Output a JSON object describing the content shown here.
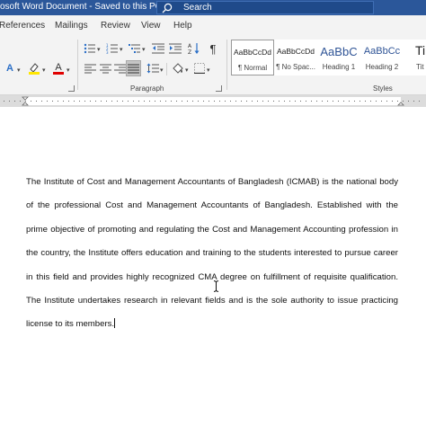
{
  "titlebar": {
    "doc_title": "osoft Word Document  -  Saved to this PC",
    "search_placeholder": "Search"
  },
  "tabs": [
    "References",
    "Mailings",
    "Review",
    "View",
    "Help"
  ],
  "ribbon": {
    "groups": {
      "paragraph": "Paragraph",
      "styles": "Styles"
    },
    "icons": {
      "row1": [
        "bullets-icon",
        "numbering-icon",
        "multilevel-list-icon",
        "decrease-indent-icon",
        "increase-indent-icon",
        "sort-icon",
        "show-formatting-icon"
      ],
      "row2": [
        "align-left-icon",
        "center-icon",
        "align-right-icon",
        "justify-icon",
        "line-spacing-icon",
        "shading-icon",
        "borders-icon"
      ],
      "font_row": [
        "text-effects-icon",
        "highlight-icon",
        "font-color-icon"
      ]
    },
    "colors": {
      "highlight": "#ffe600",
      "font_color": "#e00000",
      "accent": "#2b579a"
    },
    "styles": [
      {
        "preview": "AaBbCcDd",
        "name": "¶ Normal"
      },
      {
        "preview": "AaBbCcDd",
        "name": "¶ No Spac..."
      },
      {
        "preview": "AaBbC",
        "name": "Heading 1"
      },
      {
        "preview": "AaBbCc",
        "name": "Heading 2"
      },
      {
        "preview": "Ti",
        "name": "Tit"
      }
    ]
  },
  "document": {
    "paragraph": "The Institute of Cost and Management Accountants of Bangladesh (ICMAB) is the national body of the professional Cost and Management Accountants of Bangladesh. Established with the prime objective of promoting and regulating the Cost and Management Accounting profession in the country, the Institute offers education and training to the students interested to pursue career in this field and provides highly recognized CMA degree on fulfillment of requisite qualification. The Institute undertakes research in relevant fields and is the sole authority to issue practicing license to its members."
  }
}
